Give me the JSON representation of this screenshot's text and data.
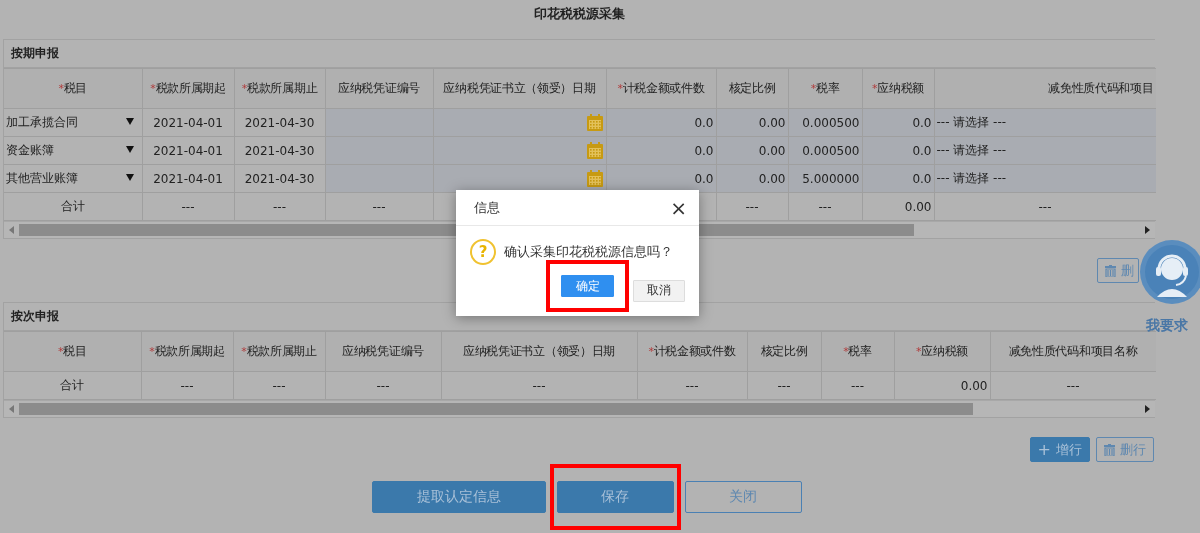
{
  "page_title": "印花税税源采集",
  "sections": [
    {
      "title": "按期申报",
      "columns": [
        {
          "label": "税目",
          "required_mark": "*",
          "kind": "item"
        },
        {
          "label": "税款所属期起",
          "required_mark": "*",
          "kind": "period_start"
        },
        {
          "label": "税款所属期止",
          "required_mark": "*",
          "kind": "period_end"
        },
        {
          "label": "应纳税凭证编号",
          "kind": "voucher_no"
        },
        {
          "label": "应纳税凭证书立（领受）日期",
          "kind": "date"
        },
        {
          "label": "计税金额或件数",
          "required_mark": "*",
          "kind": "base"
        },
        {
          "label": "核定比例",
          "kind": "ratio"
        },
        {
          "label": "税率",
          "required_mark": "*",
          "kind": "rate"
        },
        {
          "label": "应纳税额",
          "required_mark": "*",
          "kind": "amount"
        },
        {
          "label": "减免性质代码和项目",
          "kind": "relief"
        }
      ],
      "rows": [
        {
          "item": "加工承揽合同",
          "period_start": "2021-04-01",
          "period_end": "2021-04-30",
          "base": "0.0",
          "ratio": "0.00",
          "rate": "0.000500",
          "amount": "0.0",
          "relief": "--- 请选择 ---"
        },
        {
          "item": "资金账簿",
          "period_start": "2021-04-01",
          "period_end": "2021-04-30",
          "base": "0.0",
          "ratio": "0.00",
          "rate": "0.000500",
          "amount": "0.0",
          "relief": "--- 请选择 ---"
        },
        {
          "item": "其他营业账簿",
          "period_start": "2021-04-01",
          "period_end": "2021-04-30",
          "base": "0.0",
          "ratio": "0.00",
          "rate": "5.000000",
          "amount": "0.0",
          "relief": "--- 请选择 ---"
        }
      ],
      "total_row": {
        "item": "合计",
        "period_start": "---",
        "period_end": "---",
        "voucher_no": "---",
        "ratio": "---",
        "rate": "---",
        "amount": "0.00",
        "relief": "---"
      },
      "buttons": [
        {
          "kind": "delete",
          "label": "删"
        }
      ]
    },
    {
      "title": "按次申报",
      "columns": [
        {
          "label": "税目",
          "required_mark": "*",
          "kind": "item"
        },
        {
          "label": "税款所属期起",
          "required_mark": "*",
          "kind": "period_start"
        },
        {
          "label": "税款所属期止",
          "required_mark": "*",
          "kind": "period_end"
        },
        {
          "label": "应纳税凭证编号",
          "kind": "voucher_no"
        },
        {
          "label": "应纳税凭证书立（领受）日期",
          "kind": "date"
        },
        {
          "label": "计税金额或件数",
          "required_mark": "*",
          "kind": "base"
        },
        {
          "label": "核定比例",
          "kind": "ratio"
        },
        {
          "label": "税率",
          "required_mark": "*",
          "kind": "rate"
        },
        {
          "label": "应纳税额",
          "required_mark": "*",
          "kind": "amount"
        },
        {
          "label": "减免性质代码和项目名称",
          "kind": "relief"
        }
      ],
      "total_row": {
        "item": "合计",
        "period_start": "---",
        "period_end": "---",
        "voucher_no": "---",
        "date": "---",
        "base": "---",
        "ratio": "---",
        "rate": "---",
        "amount": "0.00",
        "relief": "---"
      },
      "buttons": [
        {
          "kind": "add",
          "label": "增行",
          "icon": "+"
        },
        {
          "kind": "delete",
          "label": "删行"
        }
      ]
    }
  ],
  "actions": [
    {
      "label": "提取认定信息",
      "kind": "primary",
      "highlighted": false
    },
    {
      "label": "保存",
      "kind": "primary",
      "highlighted": true
    },
    {
      "label": "关闭",
      "kind": "secondary",
      "highlighted": false
    }
  ],
  "help_widget": {
    "label": "我要求"
  },
  "dialog": {
    "title": "信息",
    "close": "×",
    "icon": "?",
    "message": "确认采集印花税税源信息吗？",
    "buttons": [
      {
        "label": "确定",
        "kind": "primary",
        "highlighted": true
      },
      {
        "label": "取消",
        "kind": "secondary",
        "highlighted": false
      }
    ]
  }
}
